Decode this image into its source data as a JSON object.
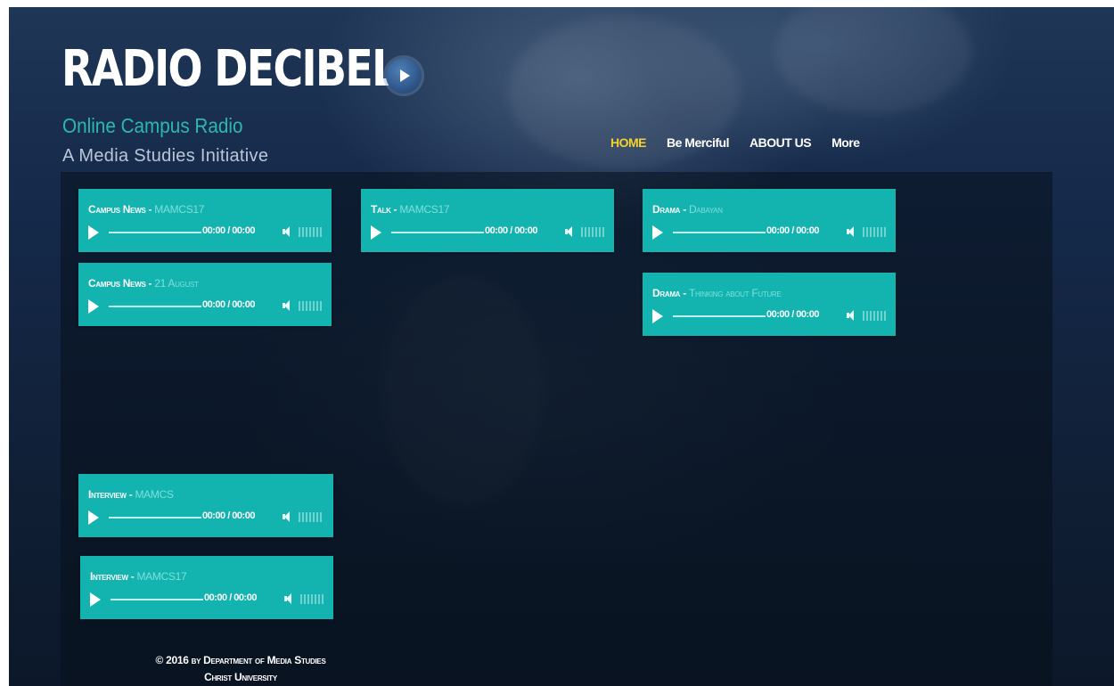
{
  "brand": {
    "logo": "RADIO DECIBEL",
    "tagline_1": "Online Campus Radio",
    "tagline_2": "A Media Studies Initiative",
    "logo_play_icon": "play-circle-icon"
  },
  "nav": {
    "items": [
      {
        "label": "HOME",
        "active": true
      },
      {
        "label": "Be Merciful",
        "active": false
      },
      {
        "label": "ABOUT US",
        "active": false
      },
      {
        "label": "More",
        "active": false
      }
    ]
  },
  "players": [
    {
      "category": "Campus News",
      "separator": " - ",
      "title": "MAMCS17",
      "time": "00:00 / 00:00"
    },
    {
      "category": "Campus News",
      "separator": " - ",
      "title": "21 August",
      "time": "00:00 / 00:00"
    },
    {
      "category": "Interview",
      "separator": " - ",
      "title": "MAMCS",
      "time": "00:00 / 00:00"
    },
    {
      "category": "Interview",
      "separator": " - ",
      "title": "MAMCS17",
      "time": "00:00 / 00:00"
    },
    {
      "category": "Talk",
      "separator": " - ",
      "title": "MAMCS17",
      "time": "00:00 / 00:00"
    },
    {
      "category": "Drama",
      "separator": " - ",
      "title": "Dabayan",
      "time": "00:00 / 00:00"
    },
    {
      "category": "Drama",
      "separator": " - ",
      "title": "Thinking about Future",
      "time": "00:00 / 00:00"
    }
  ],
  "footer": {
    "line_1": "© 2016 by Department of Media Studies",
    "line_2": "Christ University"
  },
  "colors": {
    "accent": "#13b3b0",
    "nav_active": "#f4d22b",
    "tagline": "#2bb8b0",
    "background": "#15294a"
  }
}
